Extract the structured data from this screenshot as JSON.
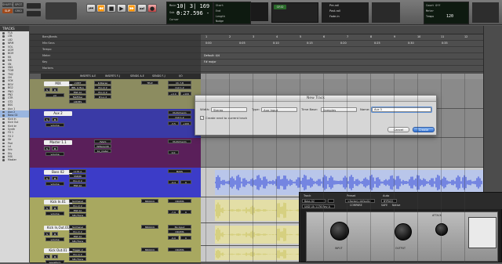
{
  "transport": {
    "mode_buttons": [
      "SHUFFLE",
      "SPOT",
      "SLIP",
      "GRID"
    ],
    "counter_main_label": "Main",
    "counter_main": "10| 3| 169 -",
    "counter_sub_label": "Sub",
    "counter_sub": "0:27.596 -",
    "cursor_label": "Cursor",
    "start_label": "Start",
    "end_label": "End",
    "length_label": "Length",
    "nudge_label": "Nudge",
    "grid_value": "GRID",
    "count_off": "Count Off",
    "meter": "Meter",
    "tempo": "Tempo",
    "tempo_value": "120",
    "preroll_label": "Pre-roll",
    "postroll_label": "Post-roll",
    "fadein_label": "Fade-in"
  },
  "tracks_panel": {
    "title": "TRACKS",
    "items": [
      "FLA",
      "LTB",
      "LB2",
      "NRM",
      "VOL",
      "ACM",
      "BCM",
      "KK",
      "KIK",
      "SN",
      "SN2",
      "TOM",
      "TM2",
      "OH",
      "VOX",
      "BGV",
      "BG2",
      "PNO",
      "PN2",
      "GTR",
      "GT2",
      "BSS",
      "Aux 1",
      "Aux 2",
      "Bass 02",
      "Kick In",
      "Kick Out",
      "Kick br",
      "Synth",
      "FX 1",
      "FX 2",
      "Str",
      "Pad",
      "Ld",
      "Vrb",
      "Dly",
      "MIX",
      "Master"
    ]
  },
  "rulers": {
    "names": [
      "Bars|Beats",
      "Min:Secs",
      "Tempo",
      "Meter",
      "Key",
      "Markers"
    ],
    "bars": [
      "1",
      "2",
      "3",
      "4",
      "5",
      "6",
      "7",
      "8",
      "9",
      "10",
      "11",
      "12"
    ],
    "times": [
      "0:00",
      "0:05",
      "0:10",
      "0:15",
      "0:20",
      "0:25",
      "0:30",
      "0:35"
    ],
    "meter_value": "Default: 4/4",
    "key_value": "F# major"
  },
  "mix_columns": [
    "INSERTS A-E",
    "INSERTS F-J",
    "SENDS A-E",
    "SENDS F-J",
    "I/O"
  ],
  "strips": [
    {
      "name": "MIX",
      "inserts": [
        "VUMT",
        "BBL G Bus",
        "ESP-1A",
        "FabFilter",
        "AIR/MS"
      ],
      "inserts2": [
        "K-Stereo",
        "Pro-Q 2",
        "Pro-Q 2",
        "Pro-L 2"
      ],
      "send": "TELE",
      "io": [
        "Ch 7-8",
        "Out 1-2"
      ],
      "vol": "vol",
      "val": "+0.0",
      "pan": "+100"
    },
    {
      "name": "Aux 2",
      "inserts": [],
      "inserts2": [],
      "send": "",
      "io": [
        "MultichanIn",
        "Out 1-2"
      ],
      "vol": "volume",
      "val": "-3.5",
      "pan": "+100"
    },
    {
      "name": "Master 1.1",
      "inserts": [],
      "inserts2": [
        "dVerb",
        "WWerenSt",
        "bx_meter"
      ],
      "send": "",
      "io": [
        "MultichanIn"
      ],
      "vol": "volume",
      "val": "0.0",
      "pan": ""
    },
    {
      "name": "Bass 02",
      "inserts": [
        "1176 A",
        "SSR/RI",
        "Pro-Q 2",
        "ESP-1A"
      ],
      "inserts2": [],
      "send": "",
      "io": [
        "BASS"
      ],
      "vol": "volume",
      "val": "-4.4",
      "pan": "0"
    },
    {
      "name": "Kick In.01",
      "inserts": [
        "SLChanel",
        "Pro-Q 2",
        "ESP-1A",
        "SPL/Trans"
      ],
      "inserts2": [],
      "send": "MIKKICK",
      "io": [
        "DRUMS"
      ],
      "vol": "volume",
      "val": "-7.9",
      "pan": "0"
    },
    {
      "name": "Kick In,Out.01",
      "inserts": [
        "SLChanel",
        "Pro-Q 2",
        "ESP-1A",
        "SPL/Trans"
      ],
      "inserts2": [],
      "send": "MIKKICK",
      "io": [
        "No Input",
        "DRUMS"
      ],
      "vol": "volume",
      "val": "-9.0",
      "pan": "0"
    },
    {
      "name": "Kick Out.01",
      "inserts": [
        "Trigger 2",
        "Pro-Q 2",
        "SPL/Trans"
      ],
      "inserts2": [],
      "send": "MIKKICK",
      "io": [
        "DRUMS"
      ],
      "vol": "waveform",
      "val": "",
      "pan": ""
    }
  ],
  "dialog": {
    "title": "New Track",
    "width_label": "Width:",
    "width_value": "Stereo",
    "type_label": "Type:",
    "type_value": "Aux Input",
    "timebase_label": "Time Base:",
    "timebase_value": "Samples",
    "name_label": "Name:",
    "name_value": "Aux 3",
    "checkbox_label": "Create next to current track",
    "cancel": "Cancel",
    "create": "Create"
  },
  "plugin": {
    "track_label": "Track",
    "preset_label": "Preset",
    "auto_label": "Auto",
    "track_value": "Bass 02",
    "preset_value": "<factory default>",
    "insert_value": "UAD UA 1176 Rev A",
    "compare": "COMPARE",
    "bypass": "BYPASS",
    "safe": "SAFE",
    "native": "Native",
    "knob_labels": [
      "INPUT",
      "OUTPUT",
      "ATTACK"
    ]
  },
  "colors": {
    "mix_strip": "#8c8c60",
    "aux_strip": "#3a3aa6",
    "master_strip": "#5a1f5a",
    "bass_strip": "#3c3cc8",
    "kick_strip": "#a8a860",
    "waveform_blue": "#2e44d8",
    "waveform_yellow": "#c8c25a"
  }
}
